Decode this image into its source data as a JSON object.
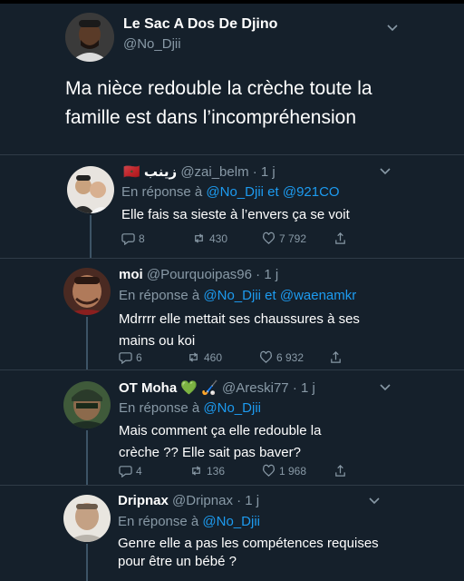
{
  "main_tweet": {
    "author_name": "Le Sac A Dos De Djino",
    "author_handle": "@No_Djii",
    "text": "Ma nièce redouble la crèche toute la famille est dans l’incompréhension"
  },
  "replies": [
    {
      "name": "زينب",
      "flag": "🇲🇦",
      "handle": "@zai_belm",
      "time": "· 1 j",
      "reply_prefix": "En réponse à",
      "mention1": "@No_Djii",
      "conj": "et",
      "mention2": "@921CO",
      "text": "Elle fais sa sieste à l’envers ça se voit",
      "comments": "8",
      "retweets": "430",
      "likes": "7 792"
    },
    {
      "name": "moi",
      "handle": "@Pourquoipas96",
      "time": "· 1 j",
      "reply_prefix": "En réponse à",
      "mention1": "@No_Djii",
      "conj": "et",
      "mention2": "@waenamkr",
      "text": "Mdrrrr elle mettait ses chaussures à ses mains ou koi",
      "comments": "6",
      "retweets": "460",
      "likes": "6 932"
    },
    {
      "name": "OT Moha",
      "emojis": "💚 🏑",
      "handle": "@Areski77",
      "time": "· 1 j",
      "reply_prefix": "En réponse à",
      "mention1": "@No_Djii",
      "text": "Mais comment ça elle redouble la crèche ?? Elle sait pas baver?",
      "comments": "4",
      "retweets": "136",
      "likes": "1 968"
    },
    {
      "name": "Dripnax",
      "handle": "@Dripnax",
      "time": "· 1 j",
      "reply_prefix": "En réponse à",
      "mention1": "@No_Djii",
      "text": "Genre elle a pas les compétences requises pour être un bébé ?"
    }
  ],
  "colors": {
    "background": "#15202b",
    "mention": "#1d9bf0",
    "secondary_text": "#8899a6"
  },
  "icons": [
    "chevron-down-icon",
    "comment-icon",
    "retweet-icon",
    "like-icon",
    "share-icon"
  ]
}
